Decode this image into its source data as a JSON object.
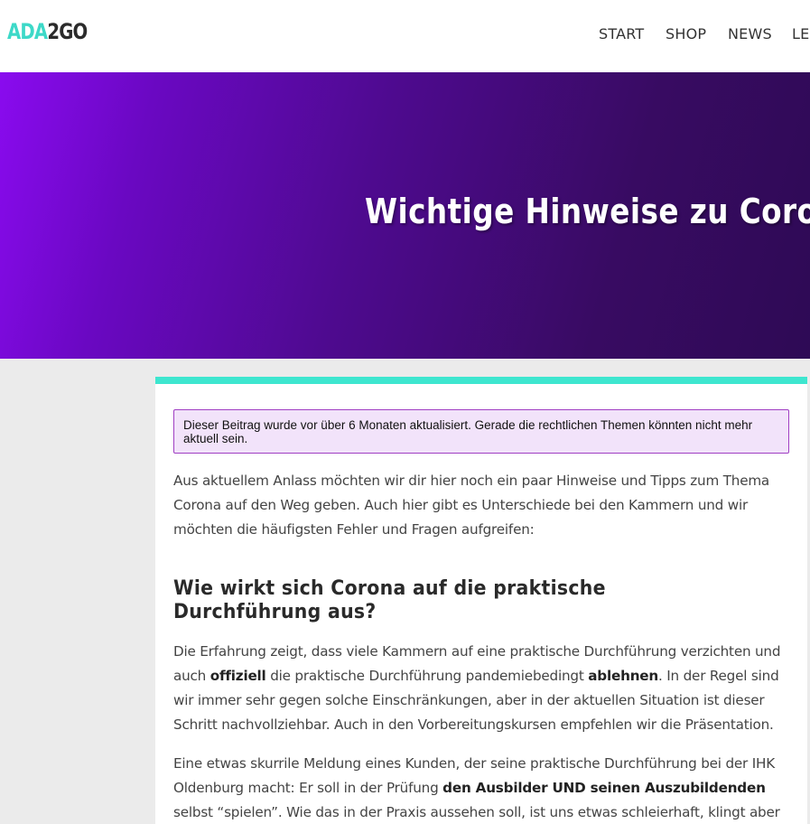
{
  "header": {
    "logo_part1": "ADA",
    "logo_part2": "2GO",
    "nav": [
      "START",
      "SHOP",
      "NEWS",
      "LEXIKON"
    ]
  },
  "hero": {
    "title": "Wichtige Hinweise zu Corona"
  },
  "article": {
    "notice": "Dieser Beitrag wurde vor über 6 Monaten aktualisiert. Gerade die rechtlichen Themen könnten nicht mehr aktuell sein.",
    "intro": "Aus aktuellem Anlass möchten wir dir hier noch ein paar Hinweise und Tipps zum Thema Corona auf den Weg geben. Auch hier gibt es Unterschiede bei den Kammern und wir möchten die häufigsten Fehler und Fragen aufgreifen:",
    "heading": "Wie wirkt sich Corona auf die praktische Durchführung aus?",
    "p1": {
      "t1": "Die Erfahrung zeigt, dass viele Kammern auf eine praktische Durchführung verzichten und auch ",
      "b1": "offiziell",
      "t2": " die praktische Durchführung pandemiebedingt ",
      "b2": "ablehnen",
      "t3": ". In der Regel sind wir immer sehr gegen solche Einschränkungen, aber in der aktuellen Situation ist dieser Schritt nachvollziehbar. Auch in den Vorbereitungskursen empfehlen wir die Präsentation."
    },
    "p2": {
      "t1": "Eine etwas skurrile Meldung eines Kunden, der seine praktische Durchführung bei der IHK Oldenburg macht: Er soll in der Prüfung ",
      "b1": "den Ausbilder UND seinen Auszubildenden",
      "t2": " selbst “spielen”. Wie das in der Praxis aussehen soll, ist uns etwas schleierhaft, klingt aber"
    }
  },
  "colors": {
    "accent": "#3ee6cf",
    "hero_start": "#8a0bef",
    "hero_end": "#2e0a55",
    "notice_border": "#a03fc3",
    "notice_bg": "#f2e3fa"
  }
}
